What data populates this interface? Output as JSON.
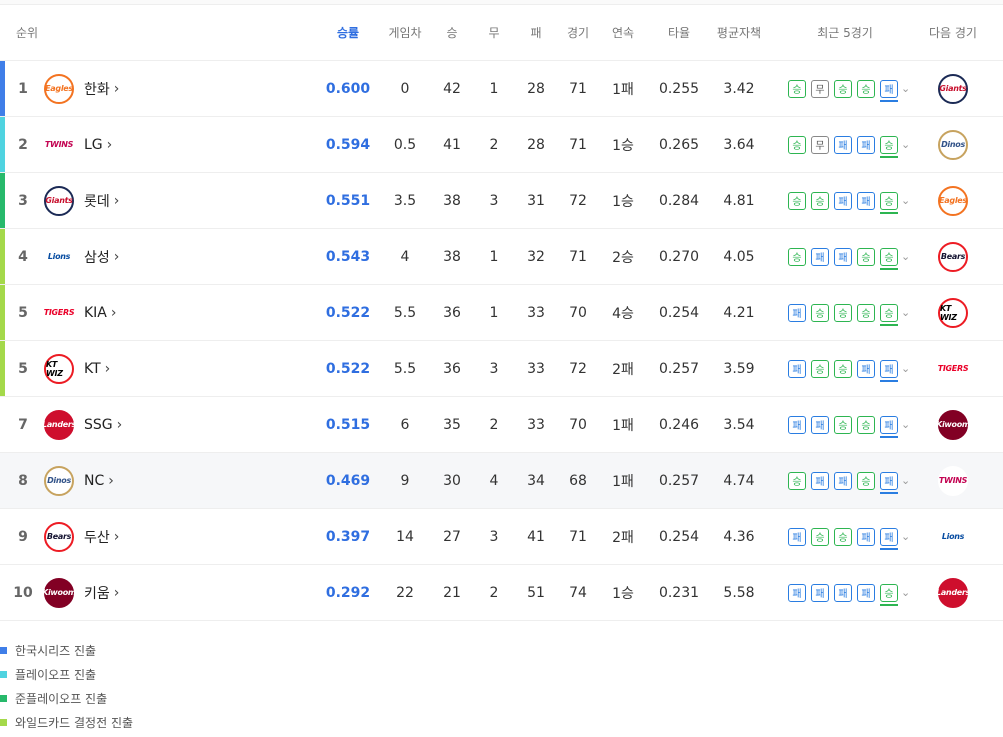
{
  "header": {
    "rank": "순위",
    "pct": "승률",
    "gb": "게임차",
    "wins": "승",
    "draws": "무",
    "losses": "패",
    "games": "경기",
    "streak": "연속",
    "avg": "타율",
    "era": "평균자책",
    "recent": "최근 5경기",
    "next": "다음 경기"
  },
  "legend": [
    {
      "label": "한국시리즈 진출",
      "color": "#3f7ee8"
    },
    {
      "label": "플레이오프 진출",
      "color": "#4fd3e0"
    },
    {
      "label": "준플레이오프 진출",
      "color": "#27b96b"
    },
    {
      "label": "와일드카드 결정전 진출",
      "color": "#a4d94a"
    }
  ],
  "icons": {
    "team_chevron": "›",
    "expand": "⌄"
  },
  "rows": [
    {
      "rank": "1",
      "team": "한화",
      "pct": "0.600",
      "gb": "0",
      "w": "42",
      "d": "1",
      "l": "28",
      "g": "71",
      "streak": "1패",
      "avg": "0.255",
      "era": "3.42",
      "recent": [
        "승",
        "무",
        "승",
        "승",
        "패"
      ],
      "bar": "#3f7ee8",
      "logo": {
        "text": "Eagles",
        "color": "#f37321",
        "bg": "#ffffff",
        "border": "#f37321"
      },
      "next": {
        "text": "Giants",
        "color": "#c8102e",
        "bg": "#ffffff",
        "border": "#1b2a55"
      }
    },
    {
      "rank": "2",
      "team": "LG",
      "pct": "0.594",
      "gb": "0.5",
      "w": "41",
      "d": "2",
      "l": "28",
      "g": "71",
      "streak": "1승",
      "avg": "0.265",
      "era": "3.64",
      "recent": [
        "승",
        "무",
        "패",
        "패",
        "승"
      ],
      "bar": "#4fd3e0",
      "logo": {
        "text": "TWINS",
        "color": "#c30452",
        "bg": "#ffffff",
        "border": "#ffffff"
      },
      "next": {
        "text": "Dinos",
        "color": "#315288",
        "bg": "#ffffff",
        "border": "#c7a35f"
      }
    },
    {
      "rank": "3",
      "team": "롯데",
      "pct": "0.551",
      "gb": "3.5",
      "w": "38",
      "d": "3",
      "l": "31",
      "g": "72",
      "streak": "1승",
      "avg": "0.284",
      "era": "4.81",
      "recent": [
        "승",
        "승",
        "패",
        "패",
        "승"
      ],
      "bar": "#27b96b",
      "logo": {
        "text": "Giants",
        "color": "#c8102e",
        "bg": "#ffffff",
        "border": "#1b2a55"
      },
      "next": {
        "text": "Eagles",
        "color": "#f37321",
        "bg": "#ffffff",
        "border": "#f37321"
      }
    },
    {
      "rank": "4",
      "team": "삼성",
      "pct": "0.543",
      "gb": "4",
      "w": "38",
      "d": "1",
      "l": "32",
      "g": "71",
      "streak": "2승",
      "avg": "0.270",
      "era": "4.05",
      "recent": [
        "승",
        "패",
        "패",
        "승",
        "승"
      ],
      "bar": "#a4d94a",
      "logo": {
        "text": "Lions",
        "color": "#074ca1",
        "bg": "#ffffff",
        "border": "#ffffff"
      },
      "next": {
        "text": "Bears",
        "color": "#131230",
        "bg": "#ffffff",
        "border": "#ed1c24"
      }
    },
    {
      "rank": "5",
      "team": "KIA",
      "pct": "0.522",
      "gb": "5.5",
      "w": "36",
      "d": "1",
      "l": "33",
      "g": "70",
      "streak": "4승",
      "avg": "0.254",
      "era": "4.21",
      "recent": [
        "패",
        "승",
        "승",
        "승",
        "승"
      ],
      "bar": "#a4d94a",
      "logo": {
        "text": "TIGERS",
        "color": "#ea0029",
        "bg": "#ffffff",
        "border": "#ffffff"
      },
      "next": {
        "text": "KT WIZ",
        "color": "#000000",
        "bg": "#ffffff",
        "border": "#ec1b23"
      }
    },
    {
      "rank": "5",
      "team": "KT",
      "pct": "0.522",
      "gb": "5.5",
      "w": "36",
      "d": "3",
      "l": "33",
      "g": "72",
      "streak": "2패",
      "avg": "0.257",
      "era": "3.59",
      "recent": [
        "패",
        "승",
        "승",
        "패",
        "패"
      ],
      "bar": "#a4d94a",
      "logo": {
        "text": "KT WIZ",
        "color": "#000000",
        "bg": "#ffffff",
        "border": "#ec1b23"
      },
      "next": {
        "text": "TIGERS",
        "color": "#ea0029",
        "bg": "#ffffff",
        "border": "#ffffff"
      }
    },
    {
      "rank": "7",
      "team": "SSG",
      "pct": "0.515",
      "gb": "6",
      "w": "35",
      "d": "2",
      "l": "33",
      "g": "70",
      "streak": "1패",
      "avg": "0.246",
      "era": "3.54",
      "recent": [
        "패",
        "패",
        "승",
        "승",
        "패"
      ],
      "bar": "",
      "logo": {
        "text": "Landers",
        "color": "#ffffff",
        "bg": "#ce0e2d",
        "border": "#ce0e2d"
      },
      "next": {
        "text": "Kiwoom",
        "color": "#ffffff",
        "bg": "#820024",
        "border": "#820024"
      }
    },
    {
      "rank": "8",
      "team": "NC",
      "pct": "0.469",
      "gb": "9",
      "w": "30",
      "d": "4",
      "l": "34",
      "g": "68",
      "streak": "1패",
      "avg": "0.257",
      "era": "4.74",
      "recent": [
        "승",
        "패",
        "패",
        "승",
        "패"
      ],
      "bar": "",
      "logo": {
        "text": "Dinos",
        "color": "#315288",
        "bg": "#ffffff",
        "border": "#c7a35f"
      },
      "next": {
        "text": "TWINS",
        "color": "#c30452",
        "bg": "#ffffff",
        "border": "#ffffff"
      }
    },
    {
      "rank": "9",
      "team": "두산",
      "pct": "0.397",
      "gb": "14",
      "w": "27",
      "d": "3",
      "l": "41",
      "g": "71",
      "streak": "2패",
      "avg": "0.254",
      "era": "4.36",
      "recent": [
        "패",
        "승",
        "승",
        "패",
        "패"
      ],
      "bar": "",
      "logo": {
        "text": "Bears",
        "color": "#131230",
        "bg": "#ffffff",
        "border": "#ed1c24"
      },
      "next": {
        "text": "Lions",
        "color": "#074ca1",
        "bg": "#ffffff",
        "border": "#ffffff"
      }
    },
    {
      "rank": "10",
      "team": "키움",
      "pct": "0.292",
      "gb": "22",
      "w": "21",
      "d": "2",
      "l": "51",
      "g": "74",
      "streak": "1승",
      "avg": "0.231",
      "era": "5.58",
      "recent": [
        "패",
        "패",
        "패",
        "패",
        "승"
      ],
      "bar": "",
      "logo": {
        "text": "Kiwoom",
        "color": "#ffffff",
        "bg": "#820024",
        "border": "#820024"
      },
      "next": {
        "text": "Landers",
        "color": "#ffffff",
        "bg": "#ce0e2d",
        "border": "#ce0e2d"
      }
    }
  ]
}
